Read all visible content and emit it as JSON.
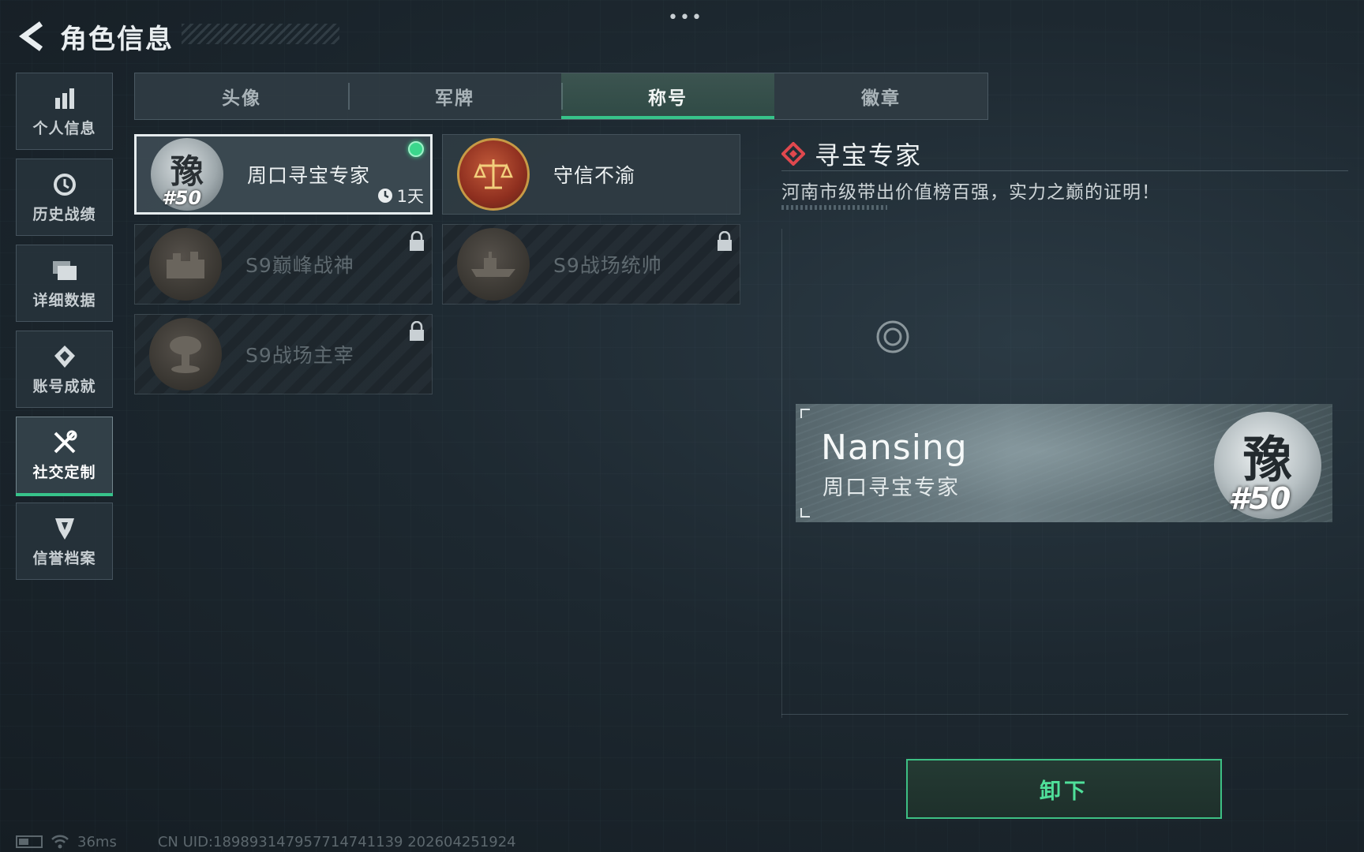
{
  "header": {
    "title": "角色信息",
    "more_label": "•••"
  },
  "sidebar": {
    "items": [
      {
        "label": "个人信息",
        "icon": "bar-chart-icon"
      },
      {
        "label": "历史战绩",
        "icon": "history-clock-icon"
      },
      {
        "label": "详细数据",
        "icon": "folder-icon"
      },
      {
        "label": "账号成就",
        "icon": "achievement-icon"
      },
      {
        "label": "社交定制",
        "icon": "tools-icon",
        "active": true
      },
      {
        "label": "信誉档案",
        "icon": "credit-shield-icon"
      }
    ]
  },
  "tabs": [
    {
      "label": "头像"
    },
    {
      "label": "军牌"
    },
    {
      "label": "称号",
      "active": true
    },
    {
      "label": "徽章"
    }
  ],
  "titles": [
    {
      "name": "周口寻宝专家",
      "emblem_text": "豫",
      "rank_text": "#50",
      "selected": true,
      "equipped": true,
      "timer": "1天",
      "locked": false
    },
    {
      "name": "守信不渝",
      "emblem": "scales-of-justice",
      "selected": false,
      "locked": false
    },
    {
      "name": "S9巅峰战神",
      "emblem": "fortress",
      "locked": true
    },
    {
      "name": "S9战场统帅",
      "emblem": "battleship",
      "locked": true
    },
    {
      "name": "S9战场主宰",
      "emblem": "mushroom-cloud",
      "locked": true
    }
  ],
  "detail": {
    "title": "寻宝专家",
    "description": "河南市级带出价值榜百强，实力之巅的证明！"
  },
  "preview": {
    "player_name": "Nansing",
    "title": "周口寻宝专家",
    "emblem_text": "豫",
    "rank_text": "#50"
  },
  "actions": {
    "unequip_label": "卸下"
  },
  "footer": {
    "ping": "36ms",
    "uid": "CN UID:18989314795771474113​9 202604251924"
  },
  "colors": {
    "accent_green": "#37c38a",
    "background": "#1d2830",
    "panel": "#303c44"
  }
}
